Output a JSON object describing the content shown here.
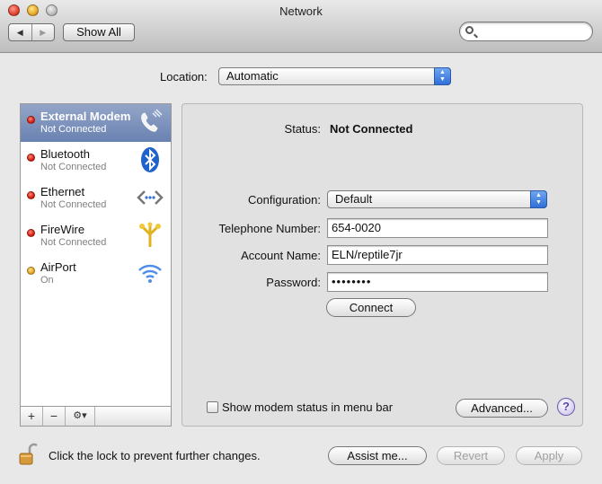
{
  "window": {
    "title": "Network"
  },
  "toolbar": {
    "back_label": "◀",
    "forward_label": "▶",
    "show_all_label": "Show All",
    "search_value": ""
  },
  "location": {
    "label": "Location:",
    "value": "Automatic"
  },
  "sidebar": {
    "services": [
      {
        "name": "External Modem",
        "status": "Not Connected",
        "status_color": "red",
        "icon": "phone-icon",
        "selected": true
      },
      {
        "name": "Bluetooth",
        "status": "Not Connected",
        "status_color": "red",
        "icon": "bluetooth-icon",
        "selected": false
      },
      {
        "name": "Ethernet",
        "status": "Not Connected",
        "status_color": "red",
        "icon": "ethernet-icon",
        "selected": false
      },
      {
        "name": "FireWire",
        "status": "Not Connected",
        "status_color": "red",
        "icon": "firewire-icon",
        "selected": false
      },
      {
        "name": "AirPort",
        "status": "On",
        "status_color": "amber",
        "icon": "airport-icon",
        "selected": false
      }
    ],
    "footer": {
      "add_label": "+",
      "remove_label": "−",
      "gear_label": "⚙▾"
    }
  },
  "detail": {
    "status_label": "Status:",
    "status_value": "Not Connected",
    "configuration_label": "Configuration:",
    "configuration_value": "Default",
    "telephone_label": "Telephone Number:",
    "telephone_value": "654-0020",
    "account_label": "Account Name:",
    "account_value": "ELN/reptile7jr",
    "password_label": "Password:",
    "password_value": "••••••••",
    "connect_label": "Connect",
    "show_modem_status_label": "Show modem status in menu bar",
    "show_modem_status_checked": false,
    "advanced_label": "Advanced...",
    "help_label": "?"
  },
  "footer": {
    "lock_text": "Click the lock to prevent further changes.",
    "assist_label": "Assist me...",
    "revert_label": "Revert",
    "apply_label": "Apply"
  },
  "colors": {
    "selection": "#7a8fbb",
    "popup_arrows": "#3b7be0",
    "status_red": "#d4180b",
    "status_amber": "#e2a21a"
  }
}
